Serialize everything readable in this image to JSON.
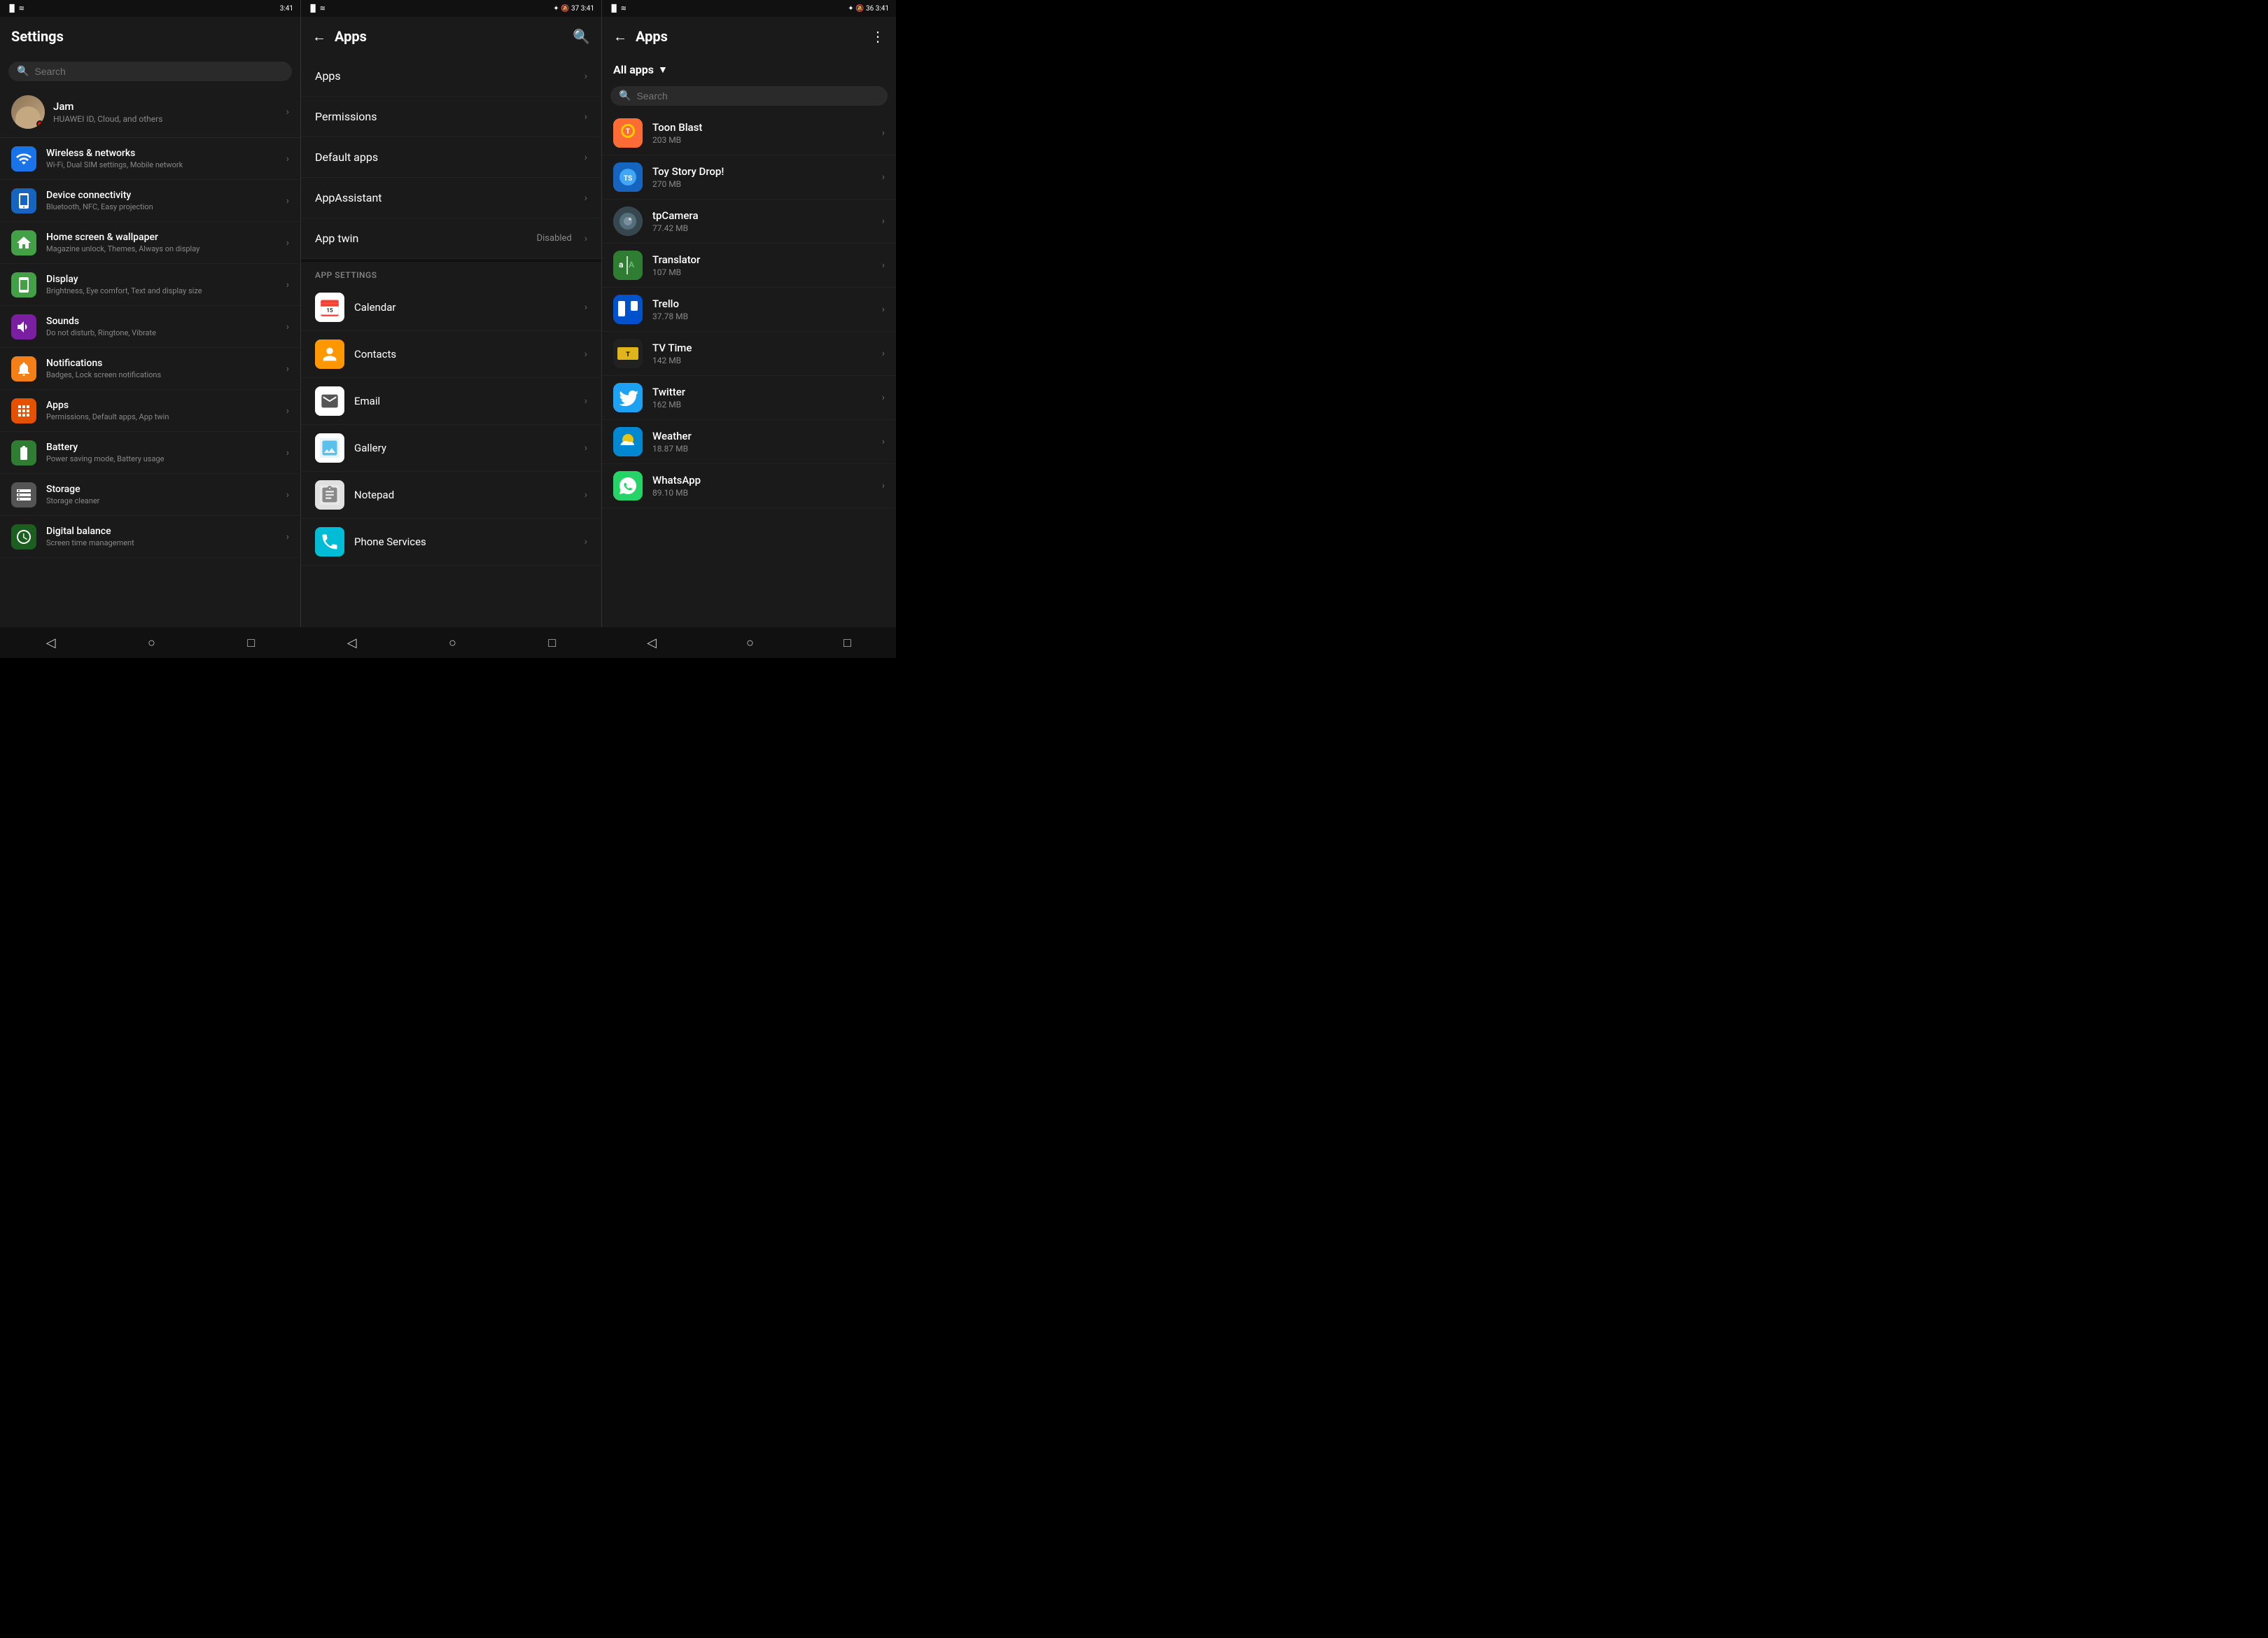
{
  "statusBar": {
    "left": {
      "signal": "▐▌",
      "wifi": "⬡",
      "time": ""
    },
    "center": {
      "bluetooth": "✦",
      "mute": "🔕",
      "battery": "37",
      "time": "3:41"
    },
    "right_mid": {
      "signal": "▐▌",
      "wifi": "⬡",
      "bluetooth": "✦",
      "mute": "🔕",
      "battery": "37",
      "time": "3:41"
    },
    "right": {
      "signal": "▐▌",
      "wifi": "⬡",
      "bluetooth": "✦",
      "mute": "🔕",
      "battery": "36",
      "time": "3:41"
    }
  },
  "leftPanel": {
    "title": "Settings",
    "search": {
      "placeholder": "Search"
    },
    "profile": {
      "name": "Jam",
      "subtitle": "HUAWEI ID, Cloud, and others"
    },
    "items": [
      {
        "id": "wireless",
        "icon": "📶",
        "iconColor": "#1a73e8",
        "title": "Wireless & networks",
        "subtitle": "Wi-Fi, Dual SIM settings, Mobile network"
      },
      {
        "id": "device",
        "icon": "⬛",
        "iconColor": "#1a73e8",
        "title": "Device connectivity",
        "subtitle": "Bluetooth, NFC, Easy projection"
      },
      {
        "id": "homescreen",
        "icon": "🏠",
        "iconColor": "#43a047",
        "title": "Home screen & wallpaper",
        "subtitle": "Magazine unlock, Themes, Always on display"
      },
      {
        "id": "display",
        "icon": "📱",
        "iconColor": "#43a047",
        "title": "Display",
        "subtitle": "Brightness, Eye comfort, Text and display size"
      },
      {
        "id": "sounds",
        "icon": "🔊",
        "iconColor": "#8e24aa",
        "title": "Sounds",
        "subtitle": "Do not disturb, Ringtone, Vibrate"
      },
      {
        "id": "notifications",
        "icon": "🔔",
        "iconColor": "#f9a825",
        "title": "Notifications",
        "subtitle": "Badges, Lock screen notifications"
      },
      {
        "id": "apps",
        "icon": "⊞",
        "iconColor": "#ffa000",
        "title": "Apps",
        "subtitle": "Permissions, Default apps, App twin"
      },
      {
        "id": "battery",
        "icon": "🔋",
        "iconColor": "#43a047",
        "title": "Battery",
        "subtitle": "Power saving mode, Battery usage"
      },
      {
        "id": "storage",
        "icon": "💾",
        "iconColor": "#555",
        "title": "Storage",
        "subtitle": "Storage cleaner"
      },
      {
        "id": "digital",
        "icon": "⏳",
        "iconColor": "#2e7d32",
        "title": "Digital balance",
        "subtitle": "Screen time management"
      }
    ]
  },
  "midPanel": {
    "title": "Apps",
    "menuItems": [
      {
        "id": "apps",
        "label": "Apps",
        "badge": ""
      },
      {
        "id": "permissions",
        "label": "Permissions",
        "badge": ""
      },
      {
        "id": "default-apps",
        "label": "Default apps",
        "badge": ""
      },
      {
        "id": "appassistant",
        "label": "AppAssistant",
        "badge": ""
      },
      {
        "id": "app-twin",
        "label": "App twin",
        "badge": "Disabled"
      }
    ],
    "sectionHeader": "APP SETTINGS",
    "appItems": [
      {
        "id": "calendar",
        "icon": "📅",
        "iconType": "calendar",
        "label": "Calendar"
      },
      {
        "id": "contacts",
        "icon": "👤",
        "iconType": "contacts",
        "label": "Contacts"
      },
      {
        "id": "email",
        "icon": "✉",
        "iconType": "email",
        "label": "Email"
      },
      {
        "id": "gallery",
        "icon": "🖼",
        "iconType": "gallery",
        "label": "Gallery"
      },
      {
        "id": "notepad",
        "icon": "📝",
        "iconType": "notepad",
        "label": "Notepad"
      },
      {
        "id": "phone-services",
        "icon": "📞",
        "iconType": "phone",
        "label": "Phone Services"
      }
    ]
  },
  "rightPanel": {
    "title": "Apps",
    "filterLabel": "All apps",
    "search": {
      "placeholder": "Search"
    },
    "apps": [
      {
        "id": "toon-blast",
        "name": "Toon Blast",
        "size": "203 MB",
        "iconType": "toon-blast"
      },
      {
        "id": "toy-story",
        "name": "Toy Story Drop!",
        "size": "270 MB",
        "iconType": "toy-story"
      },
      {
        "id": "tpcamera",
        "name": "tpCamera",
        "size": "77.42 MB",
        "iconType": "tpcamera"
      },
      {
        "id": "translator",
        "name": "Translator",
        "size": "107 MB",
        "iconType": "translator"
      },
      {
        "id": "trello",
        "name": "Trello",
        "size": "37.78 MB",
        "iconType": "trello"
      },
      {
        "id": "tv-time",
        "name": "TV Time",
        "size": "142 MB",
        "iconType": "tvtime"
      },
      {
        "id": "twitter",
        "name": "Twitter",
        "size": "162 MB",
        "iconType": "twitter"
      },
      {
        "id": "weather",
        "name": "Weather",
        "size": "18.87 MB",
        "iconType": "weather"
      },
      {
        "id": "whatsapp",
        "name": "WhatsApp",
        "size": "89.10 MB",
        "iconType": "whatsapp"
      }
    ]
  },
  "nav": {
    "back": "◁",
    "home": "○",
    "recents": "□"
  }
}
